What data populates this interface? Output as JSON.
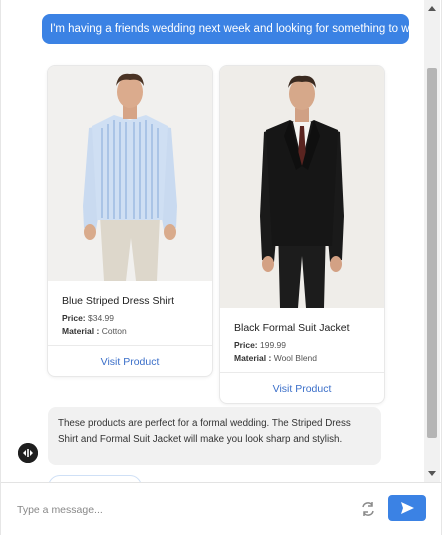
{
  "conversation": {
    "user_message": "I'm having a friends wedding next week and looking for something to wear",
    "bot_message": "These products are perfect for a formal wedding. The Striped Dress Shirt and Formal Suit Jacket will make you look sharp and stylish."
  },
  "products": [
    {
      "name": "Blue Striped Dress Shirt",
      "price_label": "Price:",
      "price": "$34.99",
      "material_label": "Material :",
      "material": "Cotton",
      "cta": "Visit Product"
    },
    {
      "name": "Black Formal Suit Jacket",
      "price_label": "Price:",
      "price": "199.99",
      "material_label": "Material :",
      "material": "Wool Blend",
      "cta": "Visit Product"
    }
  ],
  "composer": {
    "placeholder": "Type a message..."
  },
  "icons": {
    "bot_avatar": "bot-logo-icon",
    "refresh": "refresh-icon",
    "send": "send-icon"
  },
  "colors": {
    "accent": "#3b82e4",
    "link": "#3b6fc9",
    "bot_bubble": "#f1f1f1"
  }
}
